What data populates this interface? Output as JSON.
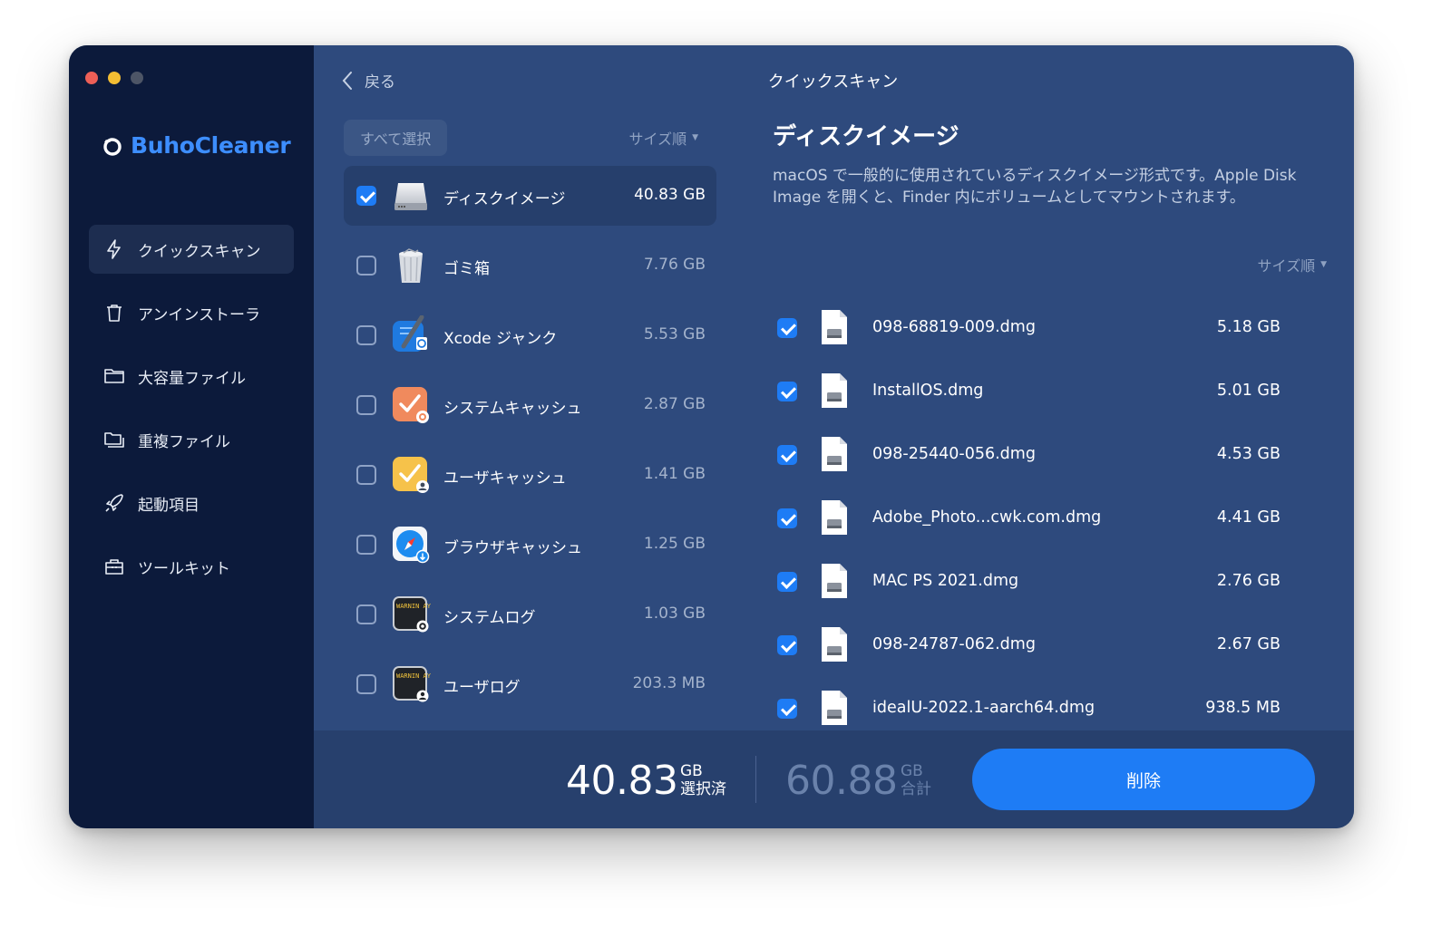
{
  "window": {
    "traffic_lights": [
      "close",
      "minimize",
      "zoom"
    ]
  },
  "brand": {
    "name": "BuhoCleaner",
    "color": "#3d8eff"
  },
  "sidebar": {
    "items": [
      {
        "label": "クイックスキャン",
        "icon": "lightning-icon",
        "active": true
      },
      {
        "label": "アンインストーラ",
        "icon": "trash-icon",
        "active": false
      },
      {
        "label": "大容量ファイル",
        "icon": "folder-icon",
        "active": false
      },
      {
        "label": "重複ファイル",
        "icon": "duplicate-folder-icon",
        "active": false
      },
      {
        "label": "起動項目",
        "icon": "rocket-icon",
        "active": false
      },
      {
        "label": "ツールキット",
        "icon": "toolbox-icon",
        "active": false
      }
    ]
  },
  "topbar": {
    "back_label": "戻る",
    "title": "クイックスキャン"
  },
  "category_list": {
    "select_all_label": "すべて選択",
    "sort_label": "サイズ順",
    "items": [
      {
        "name": "ディスクイメージ",
        "size": "40.83 GB",
        "checked": true,
        "icon": "disk-drive-icon"
      },
      {
        "name": "ゴミ箱",
        "size": "7.76 GB",
        "checked": false,
        "icon": "trash-can-icon"
      },
      {
        "name": "Xcode ジャンク",
        "size": "5.53 GB",
        "checked": false,
        "icon": "xcode-icon"
      },
      {
        "name": "システムキャッシュ",
        "size": "2.87 GB",
        "checked": false,
        "icon": "system-cache-icon"
      },
      {
        "name": "ユーザキャッシュ",
        "size": "1.41 GB",
        "checked": false,
        "icon": "user-cache-icon"
      },
      {
        "name": "ブラウザキャッシュ",
        "size": "1.25 GB",
        "checked": false,
        "icon": "safari-icon"
      },
      {
        "name": "システムログ",
        "size": "1.03 GB",
        "checked": false,
        "icon": "console-log-icon",
        "icon_text": "WARNIN AY 7:3"
      },
      {
        "name": "ユーザログ",
        "size": "203.3 MB",
        "checked": false,
        "icon": "console-user-log-icon",
        "icon_text": "WARNIN AY 7:3"
      }
    ]
  },
  "detail": {
    "title": "ディスクイメージ",
    "description": "macOS で一般的に使用されているディスクイメージ形式です。Apple Disk Image を開くと、Finder 内にボリュームとしてマウントされます。",
    "sort_label": "サイズ順",
    "files": [
      {
        "name": "098-68819-009.dmg",
        "size": "5.18 GB",
        "checked": true
      },
      {
        "name": "InstallOS.dmg",
        "size": "5.01 GB",
        "checked": true
      },
      {
        "name": "098-25440-056.dmg",
        "size": "4.53 GB",
        "checked": true
      },
      {
        "name": "Adobe_Photo...cwk.com.dmg",
        "size": "4.41 GB",
        "checked": true
      },
      {
        "name": "MAC PS 2021.dmg",
        "size": "2.76 GB",
        "checked": true
      },
      {
        "name": "098-24787-062.dmg",
        "size": "2.67 GB",
        "checked": true
      },
      {
        "name": "idealU-2022.1-aarch64.dmg",
        "size": "938.5 MB",
        "checked": true
      }
    ]
  },
  "footer": {
    "selected_value": "40.83",
    "selected_unit": "GB",
    "selected_label": "選択済",
    "total_value": "60.88",
    "total_unit": "GB",
    "total_label": "合計",
    "delete_label": "削除"
  },
  "colors": {
    "accent": "#1e7cf5",
    "sidebar_bg": "#0c1a3b",
    "main_bg": "#2e4a7d"
  }
}
